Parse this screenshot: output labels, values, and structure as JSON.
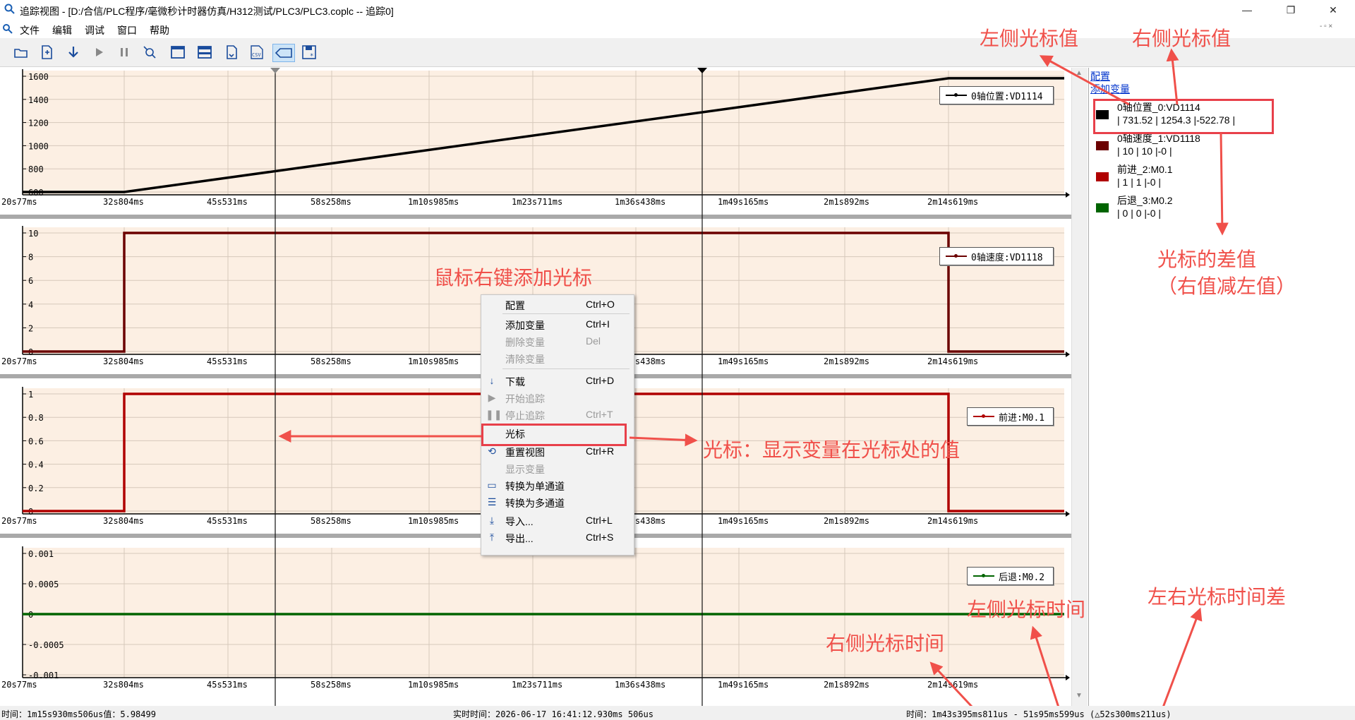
{
  "window": {
    "title": "追踪视图 - [D:/合信/PLC程序/毫微秒计时器仿真/H312测试/PLC3/PLC3.coplc -- 追踪0]",
    "minimize": "—",
    "maximize": "❐",
    "close": "✕"
  },
  "menu": [
    "文件",
    "编辑",
    "调试",
    "窗口",
    "帮助"
  ],
  "toolbar": {
    "icons": [
      "open-icon",
      "new-icon",
      "download-icon",
      "start-trace-icon",
      "stop-trace-icon",
      "reset-view-icon",
      "single-channel-icon",
      "multi-channel-icon",
      "import-icon",
      "csv-export-icon",
      "cursor-icon",
      "save-icon"
    ],
    "csv_label": "CSV"
  },
  "time_ticks": [
    "20s77ms",
    "32s804ms",
    "45s531ms",
    "58s258ms",
    "1m10s985ms",
    "1m23s711ms",
    "1m36s438ms",
    "1m49s165ms",
    "2m1s892ms",
    "2m14s619ms"
  ],
  "channels": [
    {
      "legend": "0轴位置:VD1114",
      "color": "#000000",
      "yticks": [
        "1600",
        "1400",
        "1200",
        "1000",
        "800",
        "600"
      ]
    },
    {
      "legend": "0轴速度:VD1118",
      "color": "#6b0000",
      "yticks": [
        "10",
        "8",
        "6",
        "4",
        "2",
        "0"
      ]
    },
    {
      "legend": "前进:M0.1",
      "color": "#b00000",
      "yticks": [
        "1",
        "0.8",
        "0.6",
        "0.4",
        "0.2",
        "0"
      ]
    },
    {
      "legend": "后退:M0.2",
      "color": "#006400",
      "yticks": [
        "0.001",
        "0.0005",
        "0",
        "-0.0005",
        "-0.001"
      ]
    }
  ],
  "chart_data": [
    {
      "type": "line",
      "title": "0轴位置:VD1114",
      "x": [
        "20s77ms",
        "32s804ms",
        "2m14s619ms",
        "2m23s"
      ],
      "y": [
        580,
        580,
        1580,
        1580
      ],
      "ylim": [
        580,
        1610
      ]
    },
    {
      "type": "line",
      "title": "0轴速度:VD1118",
      "x": [
        "20s77ms",
        "32s804ms",
        "32s804ms",
        "2m14s619ms",
        "2m14s619ms",
        "2m23s"
      ],
      "y": [
        0,
        0,
        10,
        10,
        0,
        0
      ],
      "ylim": [
        0,
        10
      ]
    },
    {
      "type": "line",
      "title": "前进:M0.1",
      "x": [
        "20s77ms",
        "32s804ms",
        "32s804ms",
        "2m14s619ms",
        "2m14s619ms",
        "2m23s"
      ],
      "y": [
        0,
        0,
        1,
        1,
        0,
        0
      ],
      "ylim": [
        0,
        1
      ]
    },
    {
      "type": "line",
      "title": "后退:M0.2",
      "x": [
        "20s77ms",
        "2m23s"
      ],
      "y": [
        0,
        0
      ],
      "ylim": [
        -0.001,
        0.001
      ]
    }
  ],
  "right_panel": {
    "config_link": "配置",
    "add_var_link": "添加变量",
    "vars": [
      {
        "name": "0轴位置_0:VD1114",
        "values": "| 731.52 | 1254.3 |-522.78 |",
        "color": "#000000"
      },
      {
        "name": "0轴速度_1:VD1118",
        "values": "| 10 | 10 |-0 |",
        "color": "#6b0000"
      },
      {
        "name": "前进_2:M0.1",
        "values": "| 1 | 1 |-0 |",
        "color": "#b00000"
      },
      {
        "name": "后退_3:M0.2",
        "values": "| 0 | 0 |-0 |",
        "color": "#006400"
      }
    ]
  },
  "context_menu": [
    {
      "label": "配置",
      "shortcut": "Ctrl+O",
      "disabled": false,
      "icon": ""
    },
    {
      "label": "添加变量",
      "shortcut": "Ctrl+I",
      "disabled": false,
      "icon": ""
    },
    {
      "label": "删除变量",
      "shortcut": "Del",
      "disabled": true,
      "icon": ""
    },
    {
      "label": "清除变量",
      "shortcut": "",
      "disabled": true,
      "icon": ""
    },
    {
      "label": "下载",
      "shortcut": "Ctrl+D",
      "disabled": false,
      "icon": "↓"
    },
    {
      "label": "开始追踪",
      "shortcut": "",
      "disabled": true,
      "icon": "▶"
    },
    {
      "label": "停止追踪",
      "shortcut": "Ctrl+T",
      "disabled": true,
      "icon": "❚❚"
    },
    {
      "label": "光标",
      "shortcut": "",
      "disabled": false,
      "icon": ""
    },
    {
      "label": "重置视图",
      "shortcut": "Ctrl+R",
      "disabled": false,
      "icon": "⟲"
    },
    {
      "label": "显示变量",
      "shortcut": "",
      "disabled": true,
      "icon": ""
    },
    {
      "label": "转换为单通道",
      "shortcut": "",
      "disabled": false,
      "icon": "▭"
    },
    {
      "label": "转换为多通道",
      "shortcut": "",
      "disabled": false,
      "icon": "☰"
    },
    {
      "label": "导入...",
      "shortcut": "Ctrl+L",
      "disabled": false,
      "icon": "⤓"
    },
    {
      "label": "导出...",
      "shortcut": "Ctrl+S",
      "disabled": false,
      "icon": "⤒"
    }
  ],
  "annotations": {
    "left_cursor_value": "左侧光标值",
    "right_cursor_value": "右侧光标值",
    "cursor_diff_line1": "光标的差值",
    "cursor_diff_line2": "（右值减左值）",
    "right_click_add": "鼠标右键添加光标",
    "cursor_desc": "光标：显示变量在光标处的值",
    "left_cursor_time": "左侧光标时间",
    "right_cursor_time": "右侧光标时间",
    "cursor_time_diff": "左右光标时间差"
  },
  "status": {
    "left": "时间：1m15s930ms506us值：5.98499",
    "mid": "实时时间：2026-06-17 16:41:12.930ms 506us",
    "right": "时间：1m43s395ms811us - 51s95ms599us (△52s300ms211us)"
  }
}
